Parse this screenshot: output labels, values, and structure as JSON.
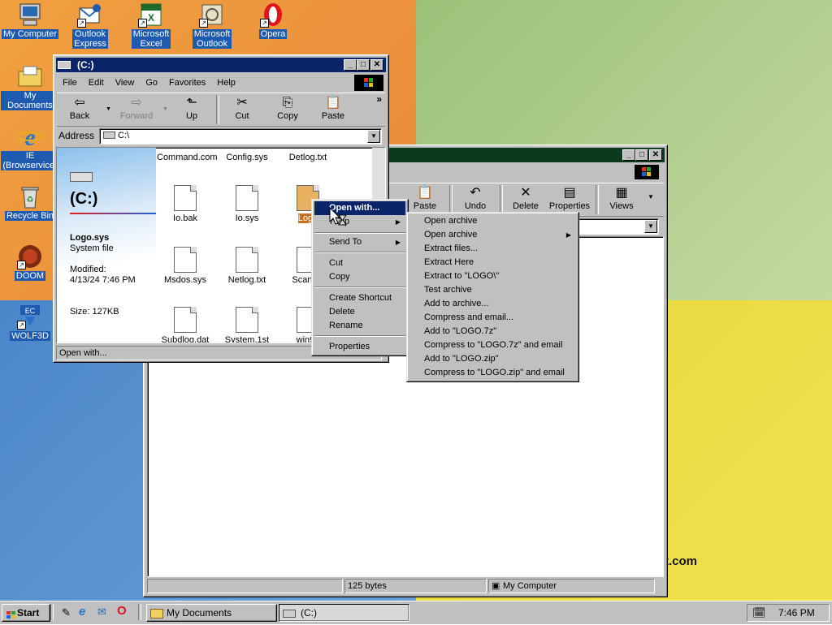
{
  "desktop": {
    "icons": [
      {
        "label": "My Computer"
      },
      {
        "label": "Outlook\nExpress"
      },
      {
        "label": "Microsoft\nExcel"
      },
      {
        "label": "Microsoft\nOutlook"
      },
      {
        "label": "Opera"
      },
      {
        "label": "My Documents"
      },
      {
        "label": "IE\n(Browservice)"
      },
      {
        "label": "Recycle Bin"
      },
      {
        "label": "DOOM"
      },
      {
        "label": "WOLF3D"
      }
    ],
    "watermark": "t.com"
  },
  "front_window": {
    "title": "(C:)",
    "menu": [
      "File",
      "Edit",
      "View",
      "Go",
      "Favorites",
      "Help"
    ],
    "toolbar": [
      "Back",
      "Forward",
      "Up",
      "Cut",
      "Copy",
      "Paste"
    ],
    "overflow": "»",
    "address_label": "Address",
    "address_value": "C:\\",
    "panel": {
      "drive_title": "(C:)",
      "file_name": "Logo.sys",
      "file_type": "System file",
      "modified_label": "Modified:",
      "modified_value": "4/13/24 7:46 PM",
      "size": "Size: 127KB"
    },
    "files_top": [
      "Command.com",
      "Config.sys",
      "Detlog.txt"
    ],
    "files_row1": [
      "Io.bak",
      "Io.sys",
      "Logo"
    ],
    "files_row2": [
      "Msdos.sys",
      "Netlog.txt",
      "Scandis"
    ],
    "files_row3": [
      "Subdlog.dat",
      "System.1st",
      "win98"
    ],
    "status": "Open with..."
  },
  "back_window": {
    "toolbar": [
      "Paste",
      "Undo",
      "Delete",
      "Properties",
      "Views"
    ],
    "status_size": "125 bytes",
    "status_location": "My Computer"
  },
  "context_menu": {
    "items": [
      "Open with...",
      "7-Zip",
      "Send To",
      "Cut",
      "Copy",
      "Create Shortcut",
      "Delete",
      "Rename",
      "Properties"
    ]
  },
  "submenu": {
    "items": [
      "Open archive",
      "Open archive",
      "Extract files...",
      "Extract Here",
      "Extract to \"LOGO\\\"",
      "Test archive",
      "Add to archive...",
      "Compress and email...",
      "Add to \"LOGO.7z\"",
      "Compress to \"LOGO.7z\" and email",
      "Add to \"LOGO.zip\"",
      "Compress to \"LOGO.zip\" and email"
    ]
  },
  "taskbar": {
    "start": "Start",
    "tasks": [
      "My Documents",
      "(C:)"
    ],
    "clock": "7:46 PM"
  }
}
